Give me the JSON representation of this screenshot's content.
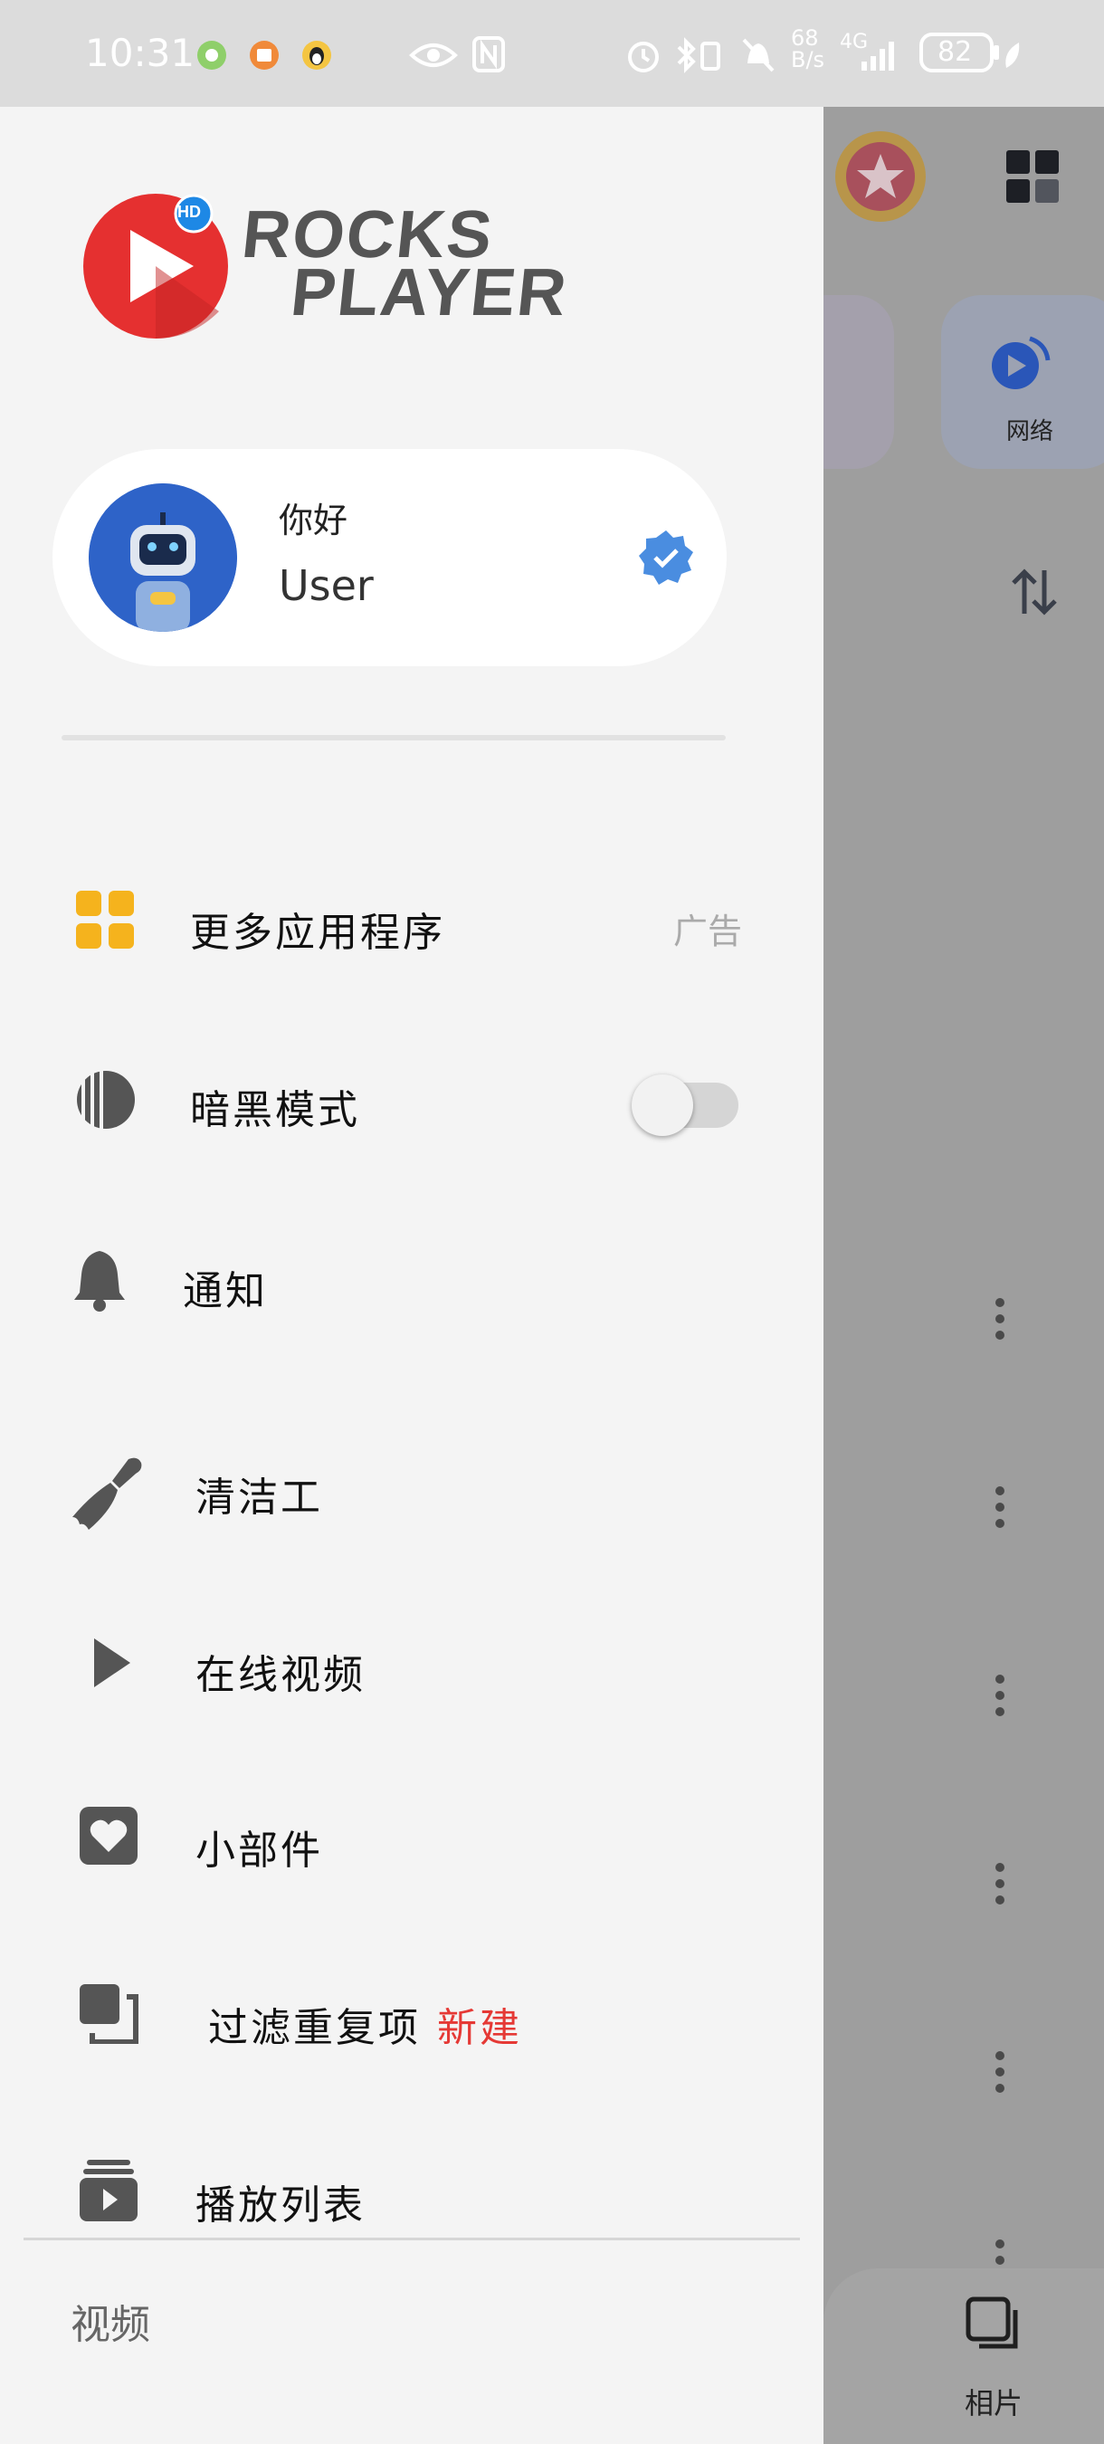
{
  "status_bar": {
    "time": "10:31",
    "net_speed_top": "68",
    "net_speed_bottom": "B/s",
    "network": "4G",
    "battery": "82"
  },
  "drawer": {
    "logo_text_top": "ROCKS",
    "logo_text_bottom": "PLAYER",
    "logo_badge": "HD",
    "user": {
      "greeting": "你好",
      "name": "User"
    },
    "menu": [
      {
        "label": "更多应用程序",
        "tag": "广告",
        "icon": "apps-grid-icon"
      },
      {
        "label": "暗黑模式",
        "toggle_on": false,
        "icon": "dark-mode-icon"
      },
      {
        "label": "通知",
        "icon": "bell-icon"
      },
      {
        "label": "清洁工",
        "icon": "broom-icon"
      },
      {
        "label": "在线视频",
        "icon": "play-icon"
      },
      {
        "label": "小部件",
        "icon": "widget-heart-icon"
      },
      {
        "label": "过滤重复项",
        "new_tag": "新建",
        "icon": "duplicate-icon"
      },
      {
        "label": "播放列表",
        "icon": "playlist-icon"
      }
    ],
    "section_title": "视频"
  },
  "background_app": {
    "network_label": "网络",
    "bottom_nav_label": "相片"
  },
  "colors": {
    "drawer_bg": "#f4f4f4",
    "accent_orange": "#f5b31d",
    "new_tag": "#e53935",
    "verified_blue": "#4a8de0",
    "logo_red": "#e53030"
  }
}
